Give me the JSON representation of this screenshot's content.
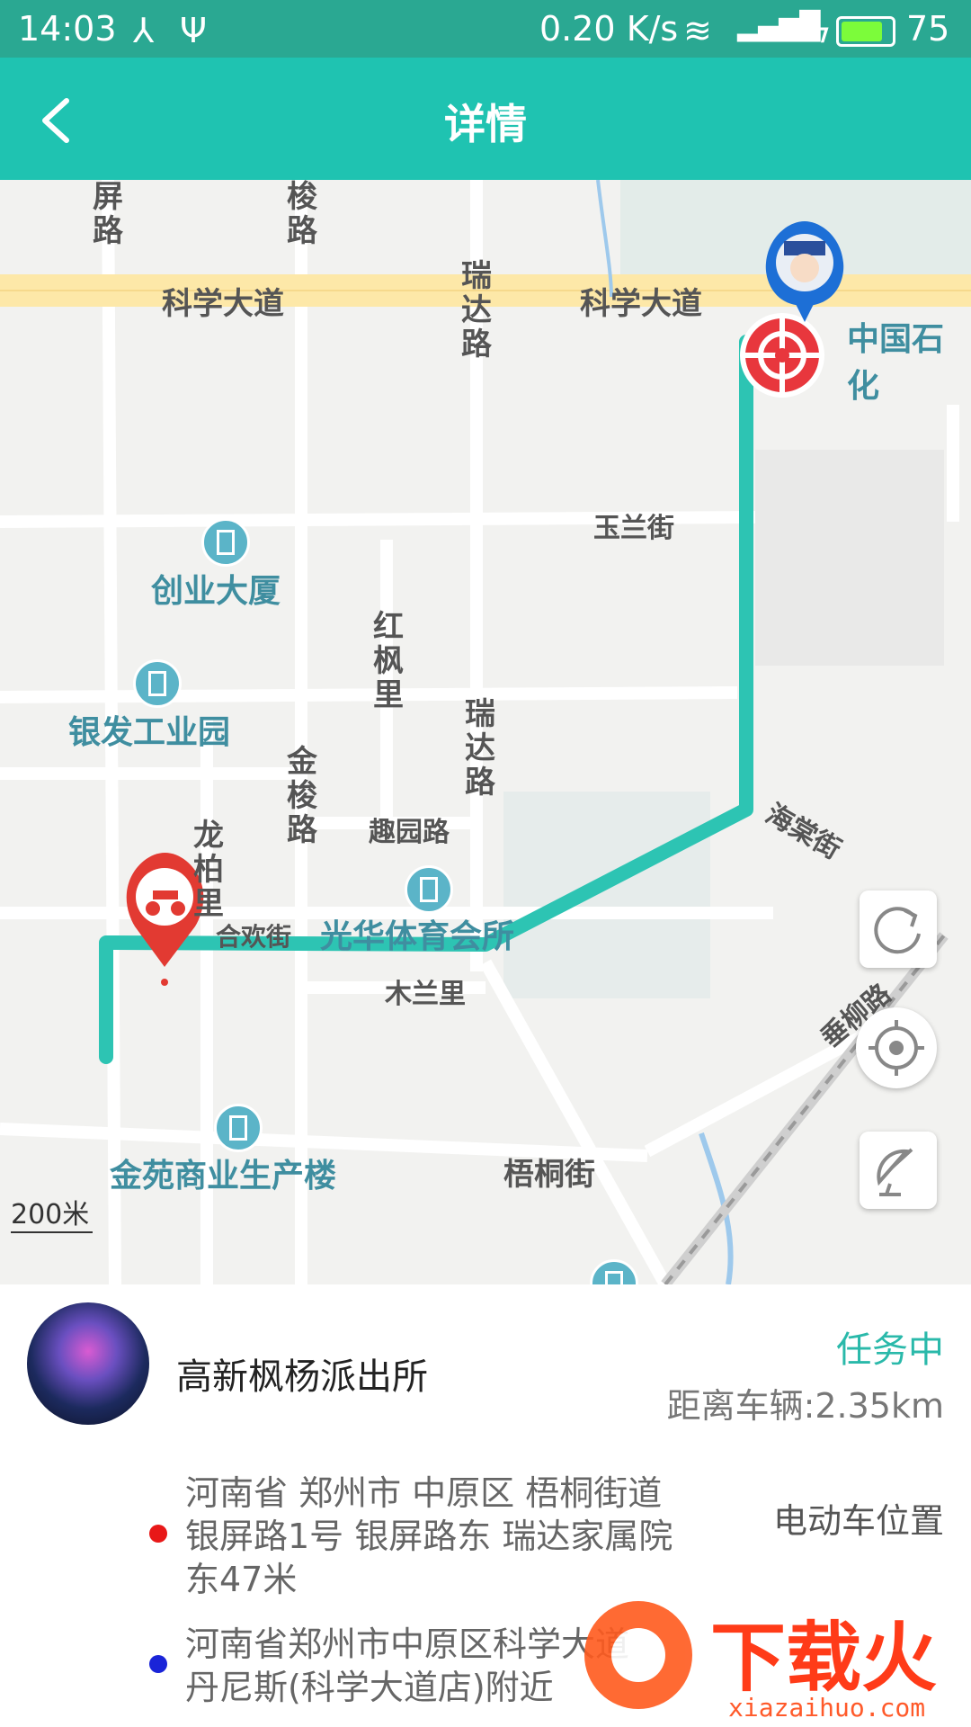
{
  "status_bar": {
    "time": "14:03",
    "network_speed": "0.20 K/s",
    "battery": "75"
  },
  "header": {
    "title": "详情"
  },
  "map": {
    "roads": {
      "kexue_left": "科学大道",
      "kexue_right": "科学大道",
      "ruida_top": "瑞达路",
      "ruida_mid": "瑞达路",
      "yulan": "玉兰街",
      "hongfeng": "红枫里",
      "jinsuo": "金梭路",
      "jinsuo_top": "梭路",
      "ping_top": "屏路",
      "longbai": "龙柏里",
      "quyuan": "趣园路",
      "haitang": "海棠街",
      "hehuan": "合欢街",
      "mulan": "木兰里",
      "wutong": "梧桐街",
      "chuiliu": "垂柳路"
    },
    "pois": {
      "chuangye": "创业大厦",
      "yinfa": "银发工业园",
      "guanghua": "光华体育会所",
      "jinyuan": "金苑商业生产楼",
      "sinopec": "中国石化"
    },
    "scale": "200米"
  },
  "panel": {
    "station_name": "高新枫杨派出所",
    "task_status": "任务中",
    "distance_label": "距离车辆:2.35km",
    "vehicle_address_line1": "河南省 郑州市 中原区 梧桐街道",
    "vehicle_address_line2": "银屏路1号 银屏路东 瑞达家属院",
    "vehicle_address_line3": "东47米",
    "vehicle_address_tag": "电动车位置",
    "police_address_line1": "河南省郑州市中原区科学大道",
    "police_address_line2": "丹尼斯(科学大道店)附近",
    "colors": {
      "accent": "#1fc3b1",
      "vehicle_dot": "#e81818",
      "police_dot": "#1a24d8"
    }
  },
  "watermark": {
    "brand": "下载火",
    "url": "xiazaihuo.com"
  }
}
